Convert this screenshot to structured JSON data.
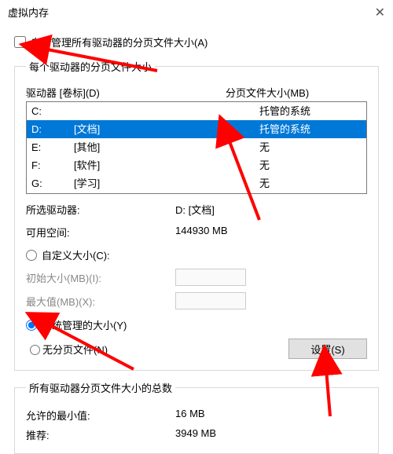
{
  "window": {
    "title": "虚拟内存",
    "close_glyph": "✕"
  },
  "auto_manage_label": "自动管理所有驱动器的分页文件大小(A)",
  "groupbox": {
    "legend": "每个驱动器的分页文件大小",
    "header_drive": "驱动器 [卷标](D)",
    "header_size": "分页文件大小(MB)",
    "drives": [
      {
        "letter": "C:",
        "label": "",
        "size": "托管的系统"
      },
      {
        "letter": "D:",
        "label": "[文档]",
        "size": "托管的系统"
      },
      {
        "letter": "E:",
        "label": "[其他]",
        "size": "无"
      },
      {
        "letter": "F:",
        "label": "[软件]",
        "size": "无"
      },
      {
        "letter": "G:",
        "label": "[学习]",
        "size": "无"
      }
    ],
    "selected_label": "所选驱动器:",
    "selected_value": "D:  [文档]",
    "available_label": "可用空间:",
    "available_value": "144930 MB",
    "radio_custom": "自定义大小(C):",
    "initial_label": "初始大小(MB)(I):",
    "max_label": "最大值(MB)(X):",
    "radio_system": "系统管理的大小(Y)",
    "radio_none": "无分页文件(N)",
    "set_button": "设置(S)"
  },
  "totals": {
    "legend": "所有驱动器分页文件大小的总数",
    "min_label": "允许的最小值:",
    "min_value": "16 MB",
    "rec_label": "推荐:",
    "rec_value": "3949 MB"
  }
}
